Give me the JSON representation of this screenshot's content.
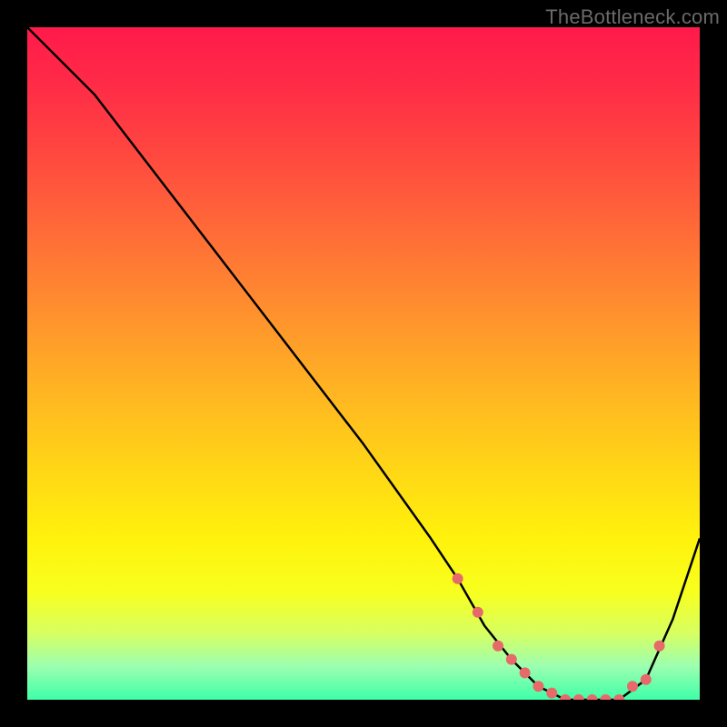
{
  "watermark": "TheBottleneck.com",
  "chart_data": {
    "type": "line",
    "title": "",
    "xlabel": "",
    "ylabel": "",
    "xlim": [
      0,
      100
    ],
    "ylim": [
      0,
      100
    ],
    "grid": false,
    "legend": false,
    "background_gradient": {
      "top": "#ff1a4b",
      "bottom": "#3effa8"
    },
    "series": [
      {
        "name": "curve",
        "color": "#000000",
        "x": [
          0,
          6,
          10,
          20,
          30,
          40,
          50,
          60,
          64,
          68,
          72,
          76,
          80,
          84,
          88,
          92,
          96,
          100
        ],
        "y": [
          100,
          94,
          90,
          77,
          64,
          51,
          38,
          24,
          18,
          11,
          6,
          2,
          0,
          0,
          0,
          3,
          12,
          24
        ]
      },
      {
        "name": "markers",
        "type": "scatter",
        "color": "#e76a6a",
        "x": [
          64,
          67,
          70,
          72,
          74,
          76,
          78,
          80,
          82,
          84,
          86,
          88,
          90,
          92,
          94
        ],
        "y": [
          18,
          13,
          8,
          6,
          4,
          2,
          1,
          0,
          0,
          0,
          0,
          0,
          2,
          3,
          8
        ]
      }
    ]
  }
}
